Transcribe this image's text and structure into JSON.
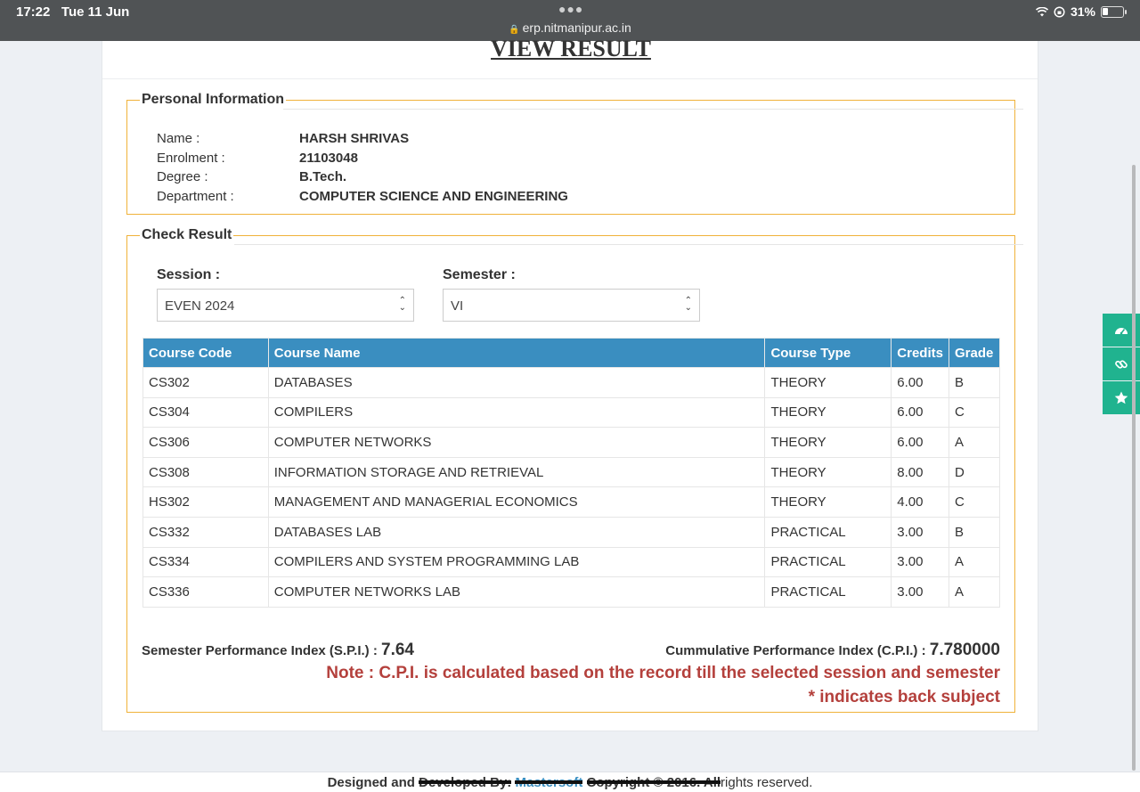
{
  "status_bar": {
    "time": "17:22",
    "date": "Tue 11 Jun",
    "url": "erp.nitmanipur.ac.in",
    "battery": "31%",
    "battery_level": 0.31
  },
  "page": {
    "title": "VIEW RESULT"
  },
  "personal_info": {
    "legend": "Personal Information",
    "rows": [
      {
        "label": "Name :",
        "value": "HARSH SHRIVAS"
      },
      {
        "label": "Enrolment :",
        "value": "21103048"
      },
      {
        "label": "Degree :",
        "value": "B.Tech."
      },
      {
        "label": "Department :",
        "value": "COMPUTER SCIENCE AND ENGINEERING"
      }
    ]
  },
  "check_result": {
    "legend": "Check Result",
    "session_label": "Session :",
    "session_value": "EVEN 2024",
    "semester_label": "Semester :",
    "semester_value": "VI"
  },
  "table": {
    "headers": [
      "Course Code",
      "Course Name",
      "Course Type",
      "Credits",
      "Grade"
    ],
    "rows": [
      [
        "CS302",
        "DATABASES",
        "THEORY",
        "6.00",
        "B"
      ],
      [
        "CS304",
        "COMPILERS",
        "THEORY",
        "6.00",
        "C"
      ],
      [
        "CS306",
        "COMPUTER NETWORKS",
        "THEORY",
        "6.00",
        "A"
      ],
      [
        "CS308",
        "INFORMATION STORAGE AND RETRIEVAL",
        "THEORY",
        "8.00",
        "D"
      ],
      [
        "HS302",
        "MANAGEMENT AND MANAGERIAL ECONOMICS",
        "THEORY",
        "4.00",
        "C"
      ],
      [
        "CS332",
        "DATABASES LAB",
        "PRACTICAL",
        "3.00",
        "B"
      ],
      [
        "CS334",
        "COMPILERS AND SYSTEM PROGRAMMING LAB",
        "PRACTICAL",
        "3.00",
        "A"
      ],
      [
        "CS336",
        "COMPUTER NETWORKS LAB",
        "PRACTICAL",
        "3.00",
        "A"
      ]
    ]
  },
  "summary": {
    "spi_label": "Semester Performance Index (S.P.I.) :",
    "spi_value": "7.64",
    "cpi_label": "Cummulative Performance Index (C.P.I.) :",
    "cpi_value": "7.780000",
    "note": "Note : C.P.I. is calculated based on the record till the selected session and semester",
    "back_note": "* indicates back subject"
  },
  "side_buttons": [
    "dashboard-icon",
    "link-icon",
    "star-icon"
  ],
  "colors": {
    "header_blue": "#3a8ec0",
    "accent_orange": "#f0b23a",
    "note_red": "#b4403c",
    "side_green": "#20b38f"
  },
  "footer": {
    "designed": "Designed and",
    "developed": "Developed By:",
    "company": "Mastersoft",
    "copyright": "Copyright © 2016. All",
    "rights": "rights reserved."
  }
}
